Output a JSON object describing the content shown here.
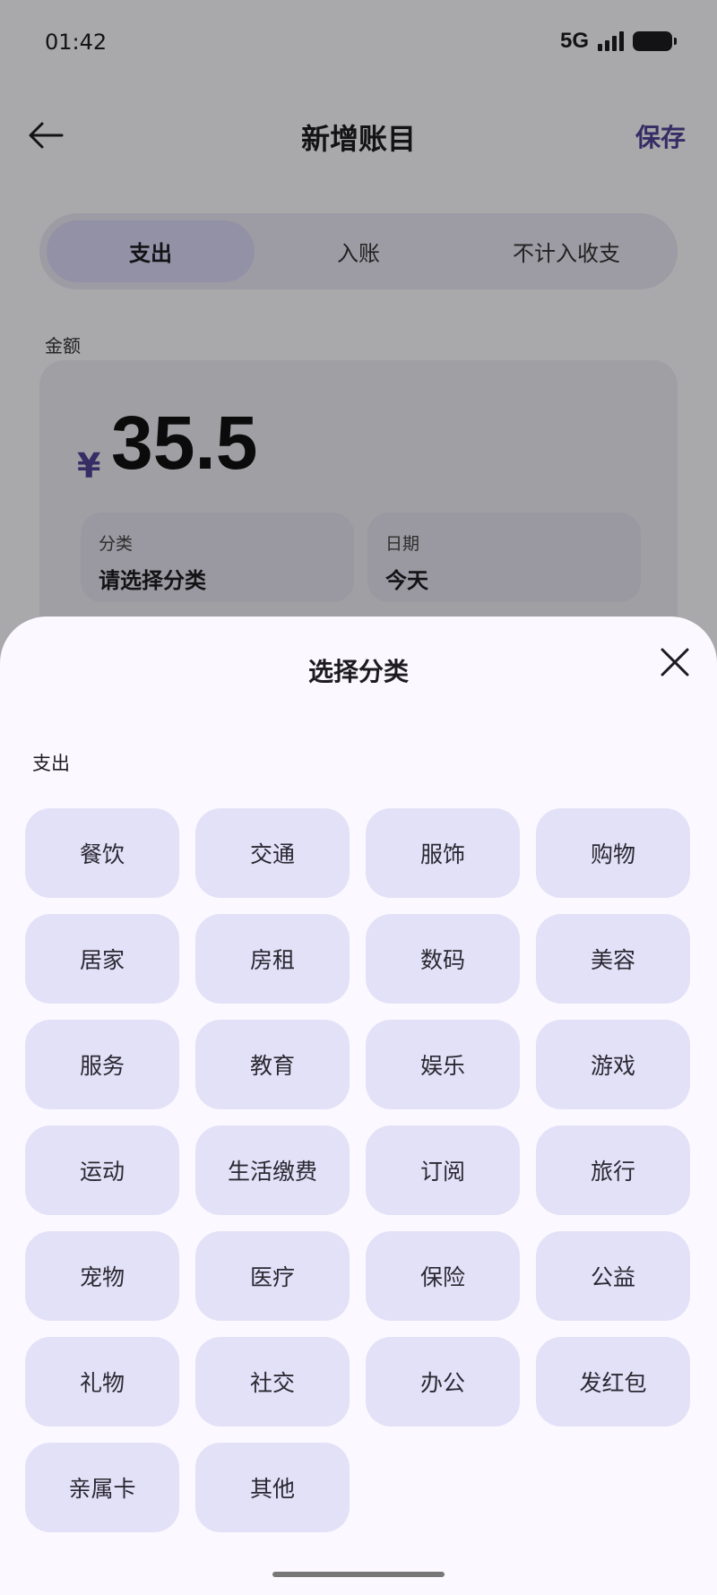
{
  "status": {
    "time": "01:42",
    "network": "5G"
  },
  "header": {
    "title": "新增账目",
    "save_label": "保存"
  },
  "type_tabs": [
    {
      "label": "支出",
      "active": true
    },
    {
      "label": "入账",
      "active": false
    },
    {
      "label": "不计入收支",
      "active": false
    }
  ],
  "amount": {
    "label": "金额",
    "currency": "¥",
    "value": "35.5"
  },
  "fields": {
    "category": {
      "label": "分类",
      "value": "请选择分类"
    },
    "date": {
      "label": "日期",
      "value": "今天"
    }
  },
  "sheet": {
    "title": "选择分类",
    "section_label": "支出",
    "categories": [
      "餐饮",
      "交通",
      "服饰",
      "购物",
      "居家",
      "房租",
      "数码",
      "美容",
      "服务",
      "教育",
      "娱乐",
      "游戏",
      "运动",
      "生活缴费",
      "订阅",
      "旅行",
      "宠物",
      "医疗",
      "保险",
      "公益",
      "礼物",
      "社交",
      "办公",
      "发红包",
      "亲属卡",
      "其他"
    ]
  },
  "colors": {
    "accent": "#4f4496",
    "chip_bg": "#e3e1f7",
    "sheet_bg": "#fbf9ff"
  }
}
